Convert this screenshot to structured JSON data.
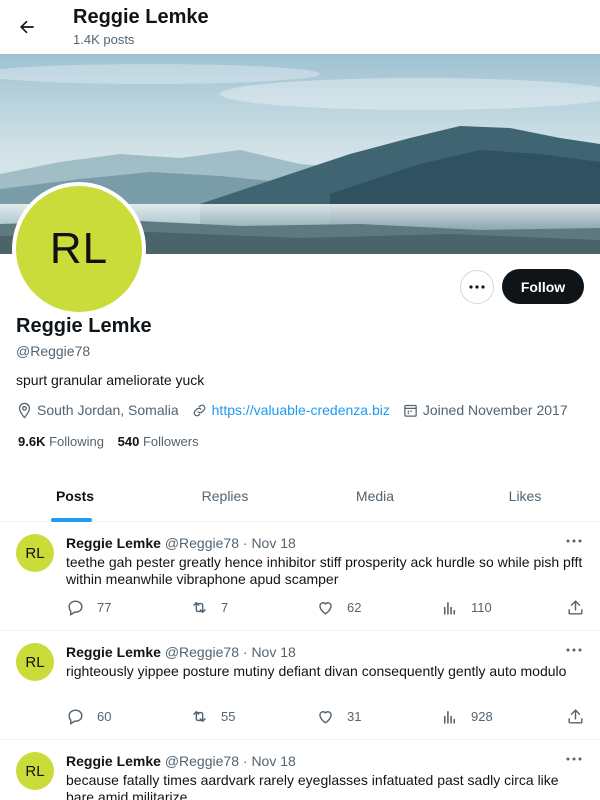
{
  "header": {
    "title": "Reggie Lemke",
    "posts_count": "1.4K posts",
    "back_icon": "arrow-left-icon"
  },
  "profile": {
    "avatar_initials": "RL",
    "avatar_color": "#c9dc3a",
    "name": "Reggie Lemke",
    "handle": "@Reggie78",
    "bio": "spurt granular ameliorate yuck",
    "location": "South Jordan, Somalia",
    "website": "https://valuable-credenza.biz",
    "joined": "Joined November 2017",
    "following_count": "9.6K",
    "following_label": "Following",
    "followers_count": "540",
    "followers_label": "Followers",
    "follow_button": "Follow",
    "more_icon": "ellipsis-icon"
  },
  "tabs": [
    {
      "label": "Posts",
      "active": true
    },
    {
      "label": "Replies",
      "active": false
    },
    {
      "label": "Media",
      "active": false
    },
    {
      "label": "Likes",
      "active": false
    }
  ],
  "posts": [
    {
      "author": "Reggie Lemke",
      "handle": "@Reggie78",
      "date": "Nov 18",
      "text": "teethe gah pester greatly hence inhibitor stiff prosperity ack hurdle so while pish pfft within meanwhile vibraphone apud scamper",
      "replies": "77",
      "reposts": "7",
      "likes": "62",
      "views": "110"
    },
    {
      "author": "Reggie Lemke",
      "handle": "@Reggie78",
      "date": "Nov 18",
      "text": "righteously yippee posture mutiny defiant divan consequently gently auto modulo",
      "replies": "60",
      "reposts": "55",
      "likes": "31",
      "views": "928"
    },
    {
      "author": "Reggie Lemke",
      "handle": "@Reggie78",
      "date": "Nov 18",
      "text": "because fatally times aardvark rarely eyeglasses infatuated past sadly circa like bare amid militarize",
      "replies": "",
      "reposts": "",
      "likes": "",
      "views": ""
    }
  ],
  "colors": {
    "accent": "#1d9bf0",
    "text_primary": "#0f1419",
    "text_secondary": "#536471",
    "follow_button_bg": "#0f1419"
  }
}
